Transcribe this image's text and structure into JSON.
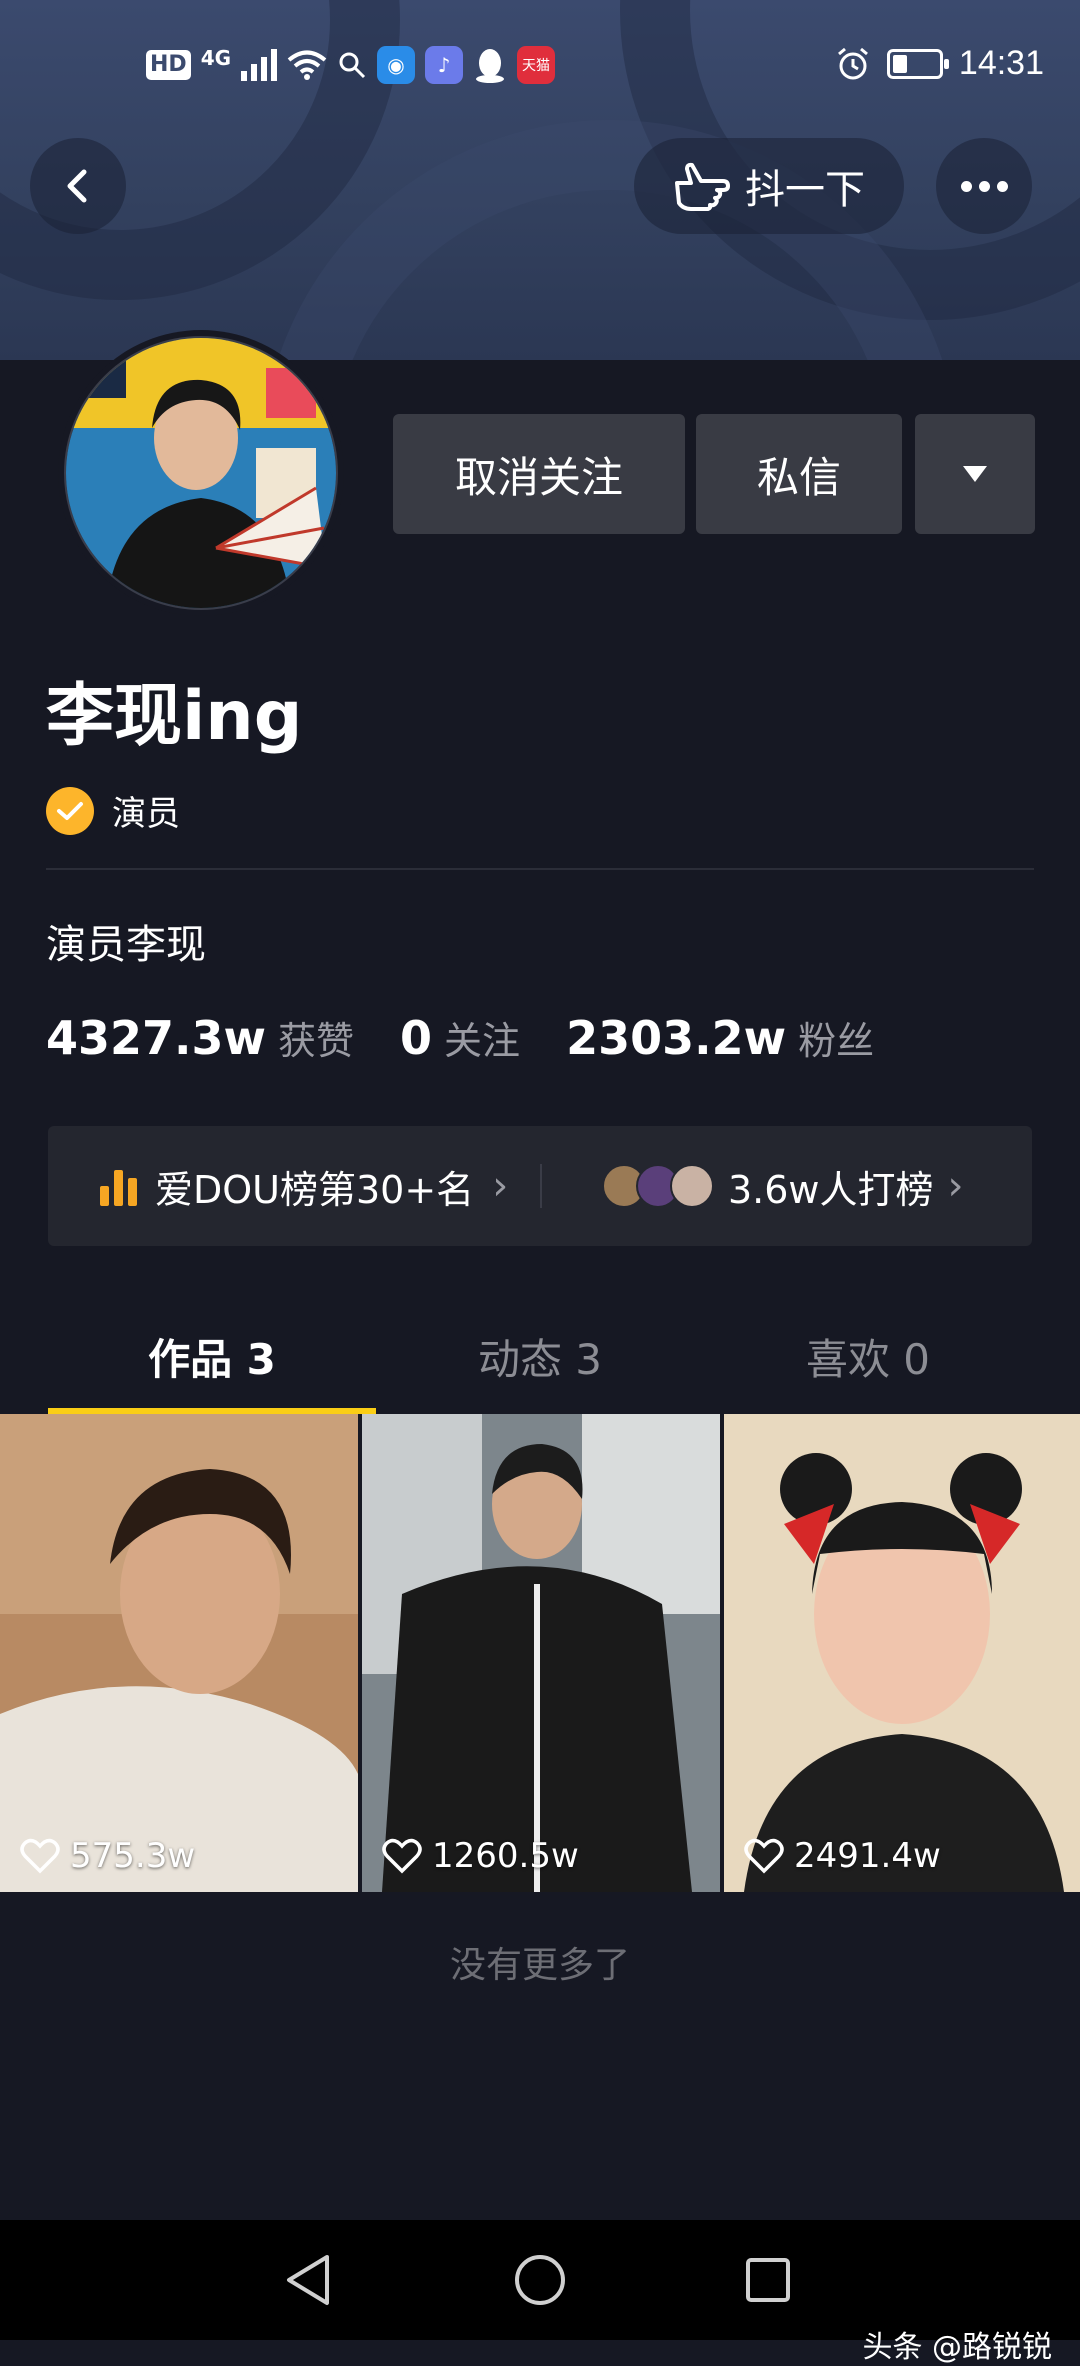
{
  "status_bar": {
    "hd": "HD",
    "network": "4G",
    "time": "14:31"
  },
  "header": {
    "shake_label": "抖一下"
  },
  "profile": {
    "name": "李现ing",
    "verified_label": "演员",
    "bio": "演员李现",
    "stats": [
      {
        "value": "4327.3w",
        "label": "获赞"
      },
      {
        "value": "0",
        "label": "关注"
      },
      {
        "value": "2303.2w",
        "label": "粉丝"
      }
    ]
  },
  "actions": {
    "unfollow": "取消关注",
    "message": "私信"
  },
  "ranking": {
    "rank_text": "爱DOU榜第30+名",
    "supporters_text": "3.6w人打榜"
  },
  "tabs": [
    {
      "label": "作品 3",
      "active": true
    },
    {
      "label": "动态 3",
      "active": false
    },
    {
      "label": "喜欢 0",
      "active": false
    }
  ],
  "videos": [
    {
      "likes": "575.3w"
    },
    {
      "likes": "1260.5w"
    },
    {
      "likes": "2491.4w"
    }
  ],
  "footer_note": "没有更多了",
  "watermark": "头条 @路锐锐",
  "colors": {
    "background": "#161823",
    "accent_tab": "#face15",
    "verify_badge": "#fdb52b",
    "rank_icon": "#f6a623"
  }
}
